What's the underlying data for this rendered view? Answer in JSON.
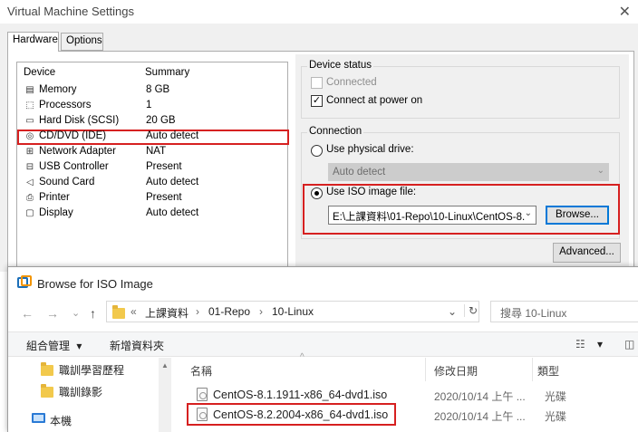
{
  "vm_settings": {
    "title": "Virtual Machine Settings",
    "close_glyph": "✕",
    "tabs": [
      {
        "label": "Hardware"
      },
      {
        "label": "Options"
      }
    ],
    "device_list": {
      "header_device": "Device",
      "header_summary": "Summary",
      "items": [
        {
          "icon": "memory-icon",
          "glyph": "▤",
          "name": "Memory",
          "summary": "8 GB"
        },
        {
          "icon": "processor-icon",
          "glyph": "⬚",
          "name": "Processors",
          "summary": "1"
        },
        {
          "icon": "hard-disk-icon",
          "glyph": "▭",
          "name": "Hard Disk (SCSI)",
          "summary": "20 GB"
        },
        {
          "icon": "cd-dvd-icon",
          "glyph": "◎",
          "name": "CD/DVD (IDE)",
          "summary": "Auto detect"
        },
        {
          "icon": "network-adapter-icon",
          "glyph": "⊞",
          "name": "Network Adapter",
          "summary": "NAT"
        },
        {
          "icon": "usb-controller-icon",
          "glyph": "⊟",
          "name": "USB Controller",
          "summary": "Present"
        },
        {
          "icon": "sound-card-icon",
          "glyph": "◁",
          "name": "Sound Card",
          "summary": "Auto detect"
        },
        {
          "icon": "printer-icon",
          "glyph": "⎙",
          "name": "Printer",
          "summary": "Present"
        },
        {
          "icon": "display-icon",
          "glyph": "▢",
          "name": "Display",
          "summary": "Auto detect"
        }
      ]
    },
    "device_status": {
      "label": "Device status",
      "connected": {
        "label": "Connected",
        "checked": false,
        "enabled": false
      },
      "connect_at_power_on": {
        "label": "Connect at power on",
        "checked": true,
        "check_glyph": "✓"
      }
    },
    "connection": {
      "label": "Connection",
      "physical_drive": {
        "label": "Use physical drive:",
        "selected": false
      },
      "physical_drive_value": "Auto detect",
      "iso_image": {
        "label": "Use ISO image file:",
        "selected": true
      },
      "iso_path": "E:\\上課資料\\01-Repo\\10-Linux\\CentOS-8.",
      "browse_label": "Browse...",
      "dropdown_glyph": "⌄"
    },
    "advanced_label": "Advanced..."
  },
  "browse_dialog": {
    "title": "Browse for ISO Image",
    "nav": {
      "back": "←",
      "forward": "→",
      "history": "⌄",
      "up": "↑"
    },
    "breadcrumb": {
      "prefix": "«",
      "parts": [
        "上課資料",
        "01-Repo",
        "10-Linux"
      ],
      "separator": "›",
      "dropdown": "⌄",
      "refresh": "↻"
    },
    "search_placeholder": "搜尋 10-Linux",
    "toolbar": {
      "organize": "組合管理",
      "organize_caret": "▾",
      "new_folder": "新增資料夾",
      "view_glyph": "☷",
      "view_caret": "▾",
      "pane_glyph": "◫"
    },
    "nav_pane": [
      {
        "label": "職訓學習歷程",
        "icon": "folder-icon"
      },
      {
        "label": "職訓錄影",
        "icon": "folder-icon"
      },
      {
        "label": "本機",
        "icon": "computer-icon"
      }
    ],
    "columns": {
      "name": "名稱",
      "modified": "修改日期",
      "type": "類型",
      "sort_glyph": "^"
    },
    "files": [
      {
        "name": "CentOS-8.1.1911-x86_64-dvd1.iso",
        "modified": "2020/10/14 上午 ...",
        "type": "光碟"
      },
      {
        "name": "CentOS-8.2.2004-x86_64-dvd1.iso",
        "modified": "2020/10/14 上午 ...",
        "type": "光碟"
      }
    ]
  }
}
